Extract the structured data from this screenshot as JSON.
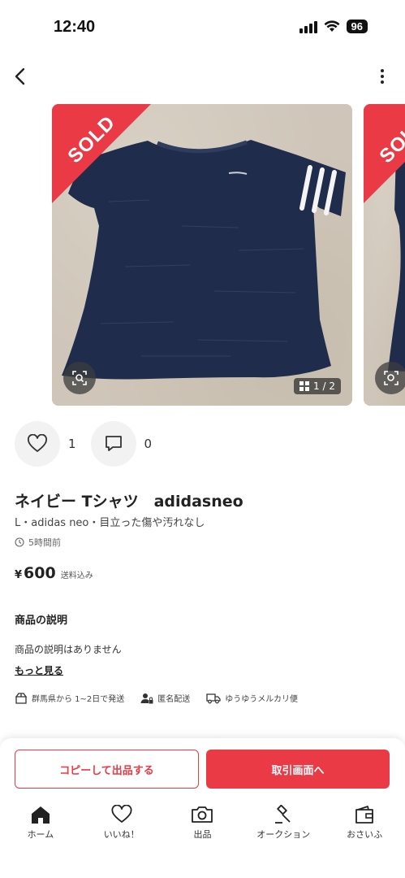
{
  "status_bar": {
    "time": "12:40",
    "battery": "96"
  },
  "product": {
    "sold_label": "SOLD",
    "image_counter": "1 / 2",
    "likes": "1",
    "comments": "0",
    "title": "ネイビー Tシャツ　adidasneo",
    "subtitle": "L・adidas neo・目立った傷や汚れなし",
    "posted": "5時間前",
    "price_currency": "¥",
    "price_value": "600",
    "price_note": "送料込み"
  },
  "description": {
    "heading": "商品の説明",
    "body": "商品の説明はありません",
    "more": "もっと見る"
  },
  "shipping": {
    "from": "群馬県から 1~2日で発送",
    "anonymous": "匿名配送",
    "method": "ゆうゆうメルカリ便"
  },
  "buttons": {
    "copy": "コピーして出品する",
    "trade": "取引画面へ"
  },
  "tabs": [
    {
      "label": "ホーム",
      "icon": "home-icon"
    },
    {
      "label": "いいね！",
      "icon": "heart-icon"
    },
    {
      "label": "出品",
      "icon": "camera-icon"
    },
    {
      "label": "オークション",
      "icon": "gavel-icon"
    },
    {
      "label": "おさいふ",
      "icon": "wallet-icon"
    }
  ],
  "colors": {
    "accent": "#ea3a45",
    "shirt": "#1f2c4c"
  }
}
